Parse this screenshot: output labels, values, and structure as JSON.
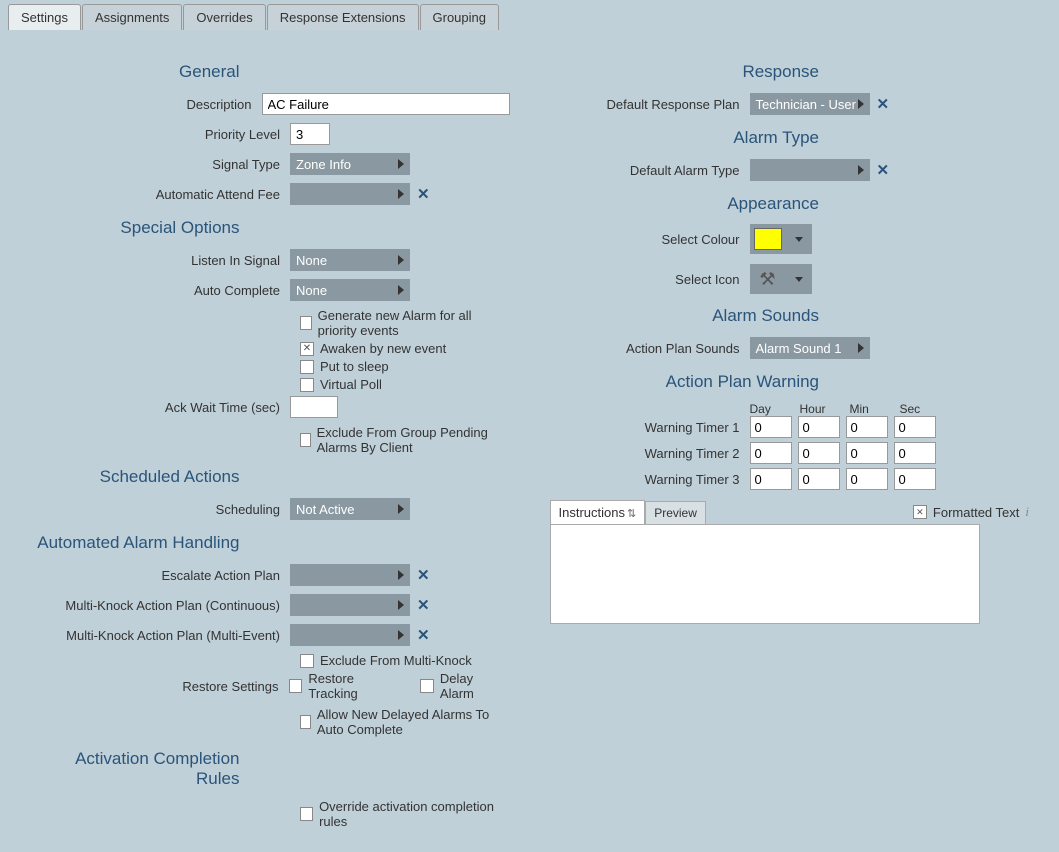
{
  "tabs": [
    "Settings",
    "Assignments",
    "Overrides",
    "Response Extensions",
    "Grouping"
  ],
  "general": {
    "title": "General",
    "description_label": "Description",
    "description_value": "AC Failure",
    "priority_label": "Priority Level",
    "priority_value": "3",
    "signal_type_label": "Signal Type",
    "signal_type_value": "Zone Info",
    "auto_fee_label": "Automatic Attend Fee",
    "auto_fee_value": ""
  },
  "special": {
    "title": "Special Options",
    "listen_label": "Listen In Signal",
    "listen_value": "None",
    "auto_complete_label": "Auto Complete",
    "auto_complete_value": "None",
    "gen_alarm": "Generate new Alarm for all priority events",
    "awaken": "Awaken by new event",
    "sleep": "Put to sleep",
    "vpoll": "Virtual Poll",
    "ack_label": "Ack Wait Time (sec)",
    "ack_value": "",
    "exclude_group": "Exclude From Group Pending Alarms By Client"
  },
  "sched": {
    "title": "Scheduled Actions",
    "scheduling_label": "Scheduling",
    "scheduling_value": "Not Active"
  },
  "auto_alarm": {
    "title": "Automated Alarm Handling",
    "escalate_label": "Escalate Action Plan",
    "mk_cont_label": "Multi-Knock Action Plan (Continuous)",
    "mk_multi_label": "Multi-Knock Action Plan (Multi-Event)",
    "exclude_mk": "Exclude From Multi-Knock",
    "restore_label": "Restore Settings",
    "restore_tracking": "Restore Tracking",
    "delay_alarm": "Delay Alarm",
    "allow_delayed": "Allow New Delayed Alarms To Auto Complete"
  },
  "act_rules": {
    "title": "Activation Completion Rules",
    "override": "Override activation completion rules"
  },
  "response": {
    "title": "Response",
    "default_plan_label": "Default Response Plan",
    "default_plan_value": "Technician - User"
  },
  "alarm_type": {
    "title": "Alarm Type",
    "default_type_label": "Default Alarm Type",
    "default_type_value": ""
  },
  "appearance": {
    "title": "Appearance",
    "colour_label": "Select Colour",
    "colour_value": "#FFFF00",
    "icon_label": "Select Icon"
  },
  "sounds": {
    "title": "Alarm Sounds",
    "action_sounds_label": "Action Plan Sounds",
    "action_sounds_value": "Alarm Sound 1"
  },
  "warning": {
    "title": "Action Plan Warning",
    "hdr": {
      "day": "Day",
      "hour": "Hour",
      "min": "Min",
      "sec": "Sec"
    },
    "t1_label": "Warning Timer 1",
    "t2_label": "Warning Timer 2",
    "t3_label": "Warning Timer 3",
    "zero": "0"
  },
  "instr": {
    "instructions_tab": "Instructions",
    "preview_tab": "Preview",
    "formatted": "Formatted Text",
    "info": "i"
  },
  "glyph": {
    "x": "✕",
    "check": "✕",
    "tool": "⚒"
  }
}
